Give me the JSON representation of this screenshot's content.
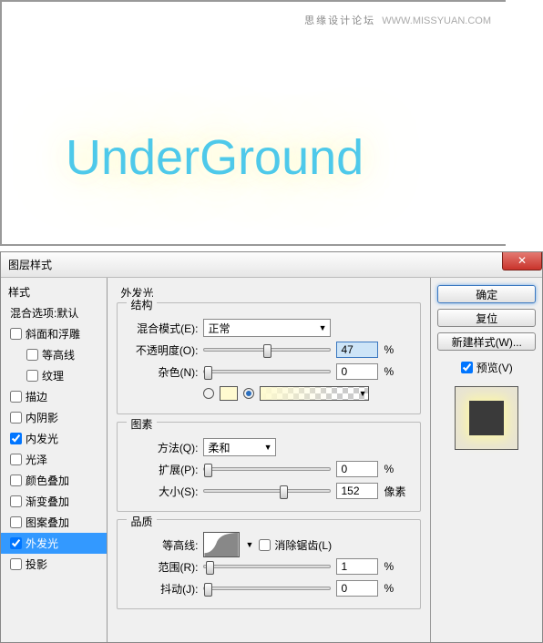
{
  "preview": {
    "watermark_bold": "思缘设计论坛",
    "watermark_url": "WWW.MISSYUAN.COM",
    "demo_text": "UnderGround"
  },
  "dialog": {
    "title": "图层样式",
    "close_label": "✕",
    "main_title": "外发光",
    "styles_header": "样式",
    "blend_default": "混合选项:默认",
    "style_items": [
      {
        "label": "斜面和浮雕",
        "checked": false,
        "sub": false
      },
      {
        "label": "等高线",
        "checked": false,
        "sub": true
      },
      {
        "label": "纹理",
        "checked": false,
        "sub": true
      },
      {
        "label": "描边",
        "checked": false,
        "sub": false
      },
      {
        "label": "内阴影",
        "checked": false,
        "sub": false
      },
      {
        "label": "内发光",
        "checked": true,
        "sub": false
      },
      {
        "label": "光泽",
        "checked": false,
        "sub": false
      },
      {
        "label": "颜色叠加",
        "checked": false,
        "sub": false
      },
      {
        "label": "渐变叠加",
        "checked": false,
        "sub": false
      },
      {
        "label": "图案叠加",
        "checked": false,
        "sub": false
      },
      {
        "label": "外发光",
        "checked": true,
        "sub": false,
        "selected": true
      },
      {
        "label": "投影",
        "checked": false,
        "sub": false
      }
    ],
    "structure": {
      "legend": "结构",
      "blend_mode_label": "混合模式(E):",
      "blend_mode_value": "正常",
      "opacity_label": "不透明度(O):",
      "opacity_value": "47",
      "opacity_unit": "%",
      "noise_label": "杂色(N):",
      "noise_value": "0",
      "noise_unit": "%",
      "color_hex": "#fffad0",
      "gradient_selected": true
    },
    "elements": {
      "legend": "图素",
      "technique_label": "方法(Q):",
      "technique_value": "柔和",
      "spread_label": "扩展(P):",
      "spread_value": "0",
      "spread_unit": "%",
      "size_label": "大小(S):",
      "size_value": "152",
      "size_unit": "像素"
    },
    "quality": {
      "legend": "品质",
      "contour_label": "等高线:",
      "antialias_label": "消除锯齿(L)",
      "range_label": "范围(R):",
      "range_value": "1",
      "range_unit": "%",
      "jitter_label": "抖动(J):",
      "jitter_value": "0",
      "jitter_unit": "%"
    },
    "right": {
      "ok": "确定",
      "reset": "复位",
      "new_style": "新建样式(W)...",
      "preview_label": "预览(V)"
    }
  }
}
